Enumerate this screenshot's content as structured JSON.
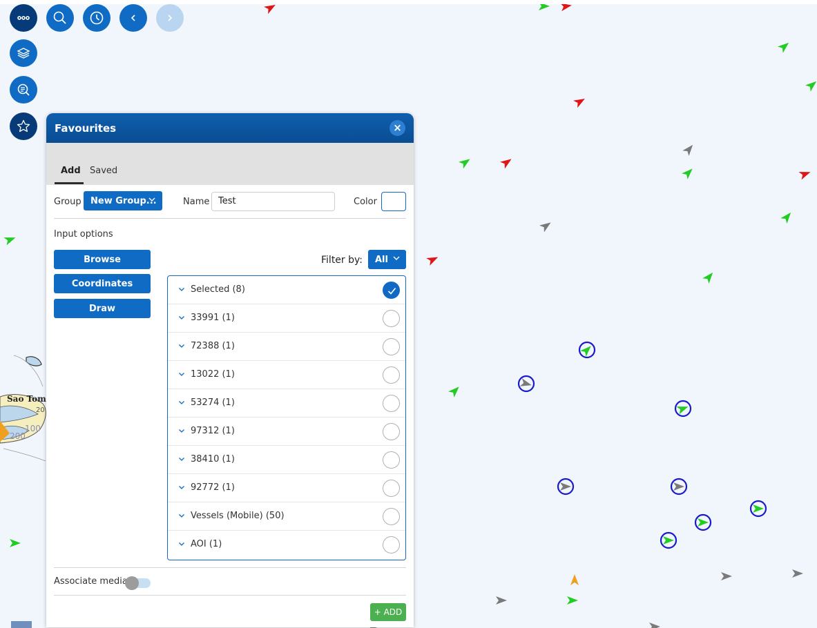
{
  "toolbar": {
    "buttons": [
      {
        "name": "menu-button",
        "icon": "more-dots-icon"
      },
      {
        "name": "search-button",
        "icon": "search-icon"
      },
      {
        "name": "history-button",
        "icon": "clock-icon"
      },
      {
        "name": "back-button",
        "icon": "chevron-left-icon"
      },
      {
        "name": "forward-button",
        "icon": "chevron-right-icon",
        "disabled": true
      },
      {
        "name": "layers-button",
        "icon": "layers-icon"
      },
      {
        "name": "zoom-search-button",
        "icon": "zoom-search-icon"
      },
      {
        "name": "favourites-button",
        "icon": "star-icon",
        "active": true
      }
    ]
  },
  "map": {
    "labels": {
      "place": "Sao Tom",
      "depth1": "20",
      "depth2": "100",
      "depth3": "200"
    },
    "colors": {
      "water": "#f1f5fc",
      "land": "#f5efc0",
      "shoal": "#bcd6ec",
      "green": "#22cc22",
      "red": "#e01515",
      "gray": "#7a7a7a",
      "orange": "#f0a020",
      "ring": "#1a1acc"
    }
  },
  "panel": {
    "title": "Favourites",
    "close_label": "×",
    "tabs": {
      "add": "Add",
      "saved": "Saved"
    },
    "group_label": "Group",
    "group_value": "New Group...",
    "name_label": "Name",
    "name_value": "Test",
    "color_label": "Color",
    "input_options_label": "Input options",
    "input_buttons": {
      "browse": "Browse",
      "coordinates": "Coordinates",
      "draw": "Draw"
    },
    "filter_label": "Filter by:",
    "filter_value": "All",
    "list": [
      {
        "label": "Selected (8)",
        "checked": true
      },
      {
        "label": "33991 (1)",
        "checked": false
      },
      {
        "label": "72388 (1)",
        "checked": false
      },
      {
        "label": "13022 (1)",
        "checked": false
      },
      {
        "label": "53274 (1)",
        "checked": false
      },
      {
        "label": "97312 (1)",
        "checked": false
      },
      {
        "label": "38410 (1)",
        "checked": false
      },
      {
        "label": "92772 (1)",
        "checked": false
      },
      {
        "label": "Vessels (Mobile) (50)",
        "checked": false
      },
      {
        "label": "AOI (1)",
        "checked": false
      }
    ],
    "associate_media_label": "Associate media",
    "associate_media_on": false,
    "add_button": "+ ADD"
  }
}
